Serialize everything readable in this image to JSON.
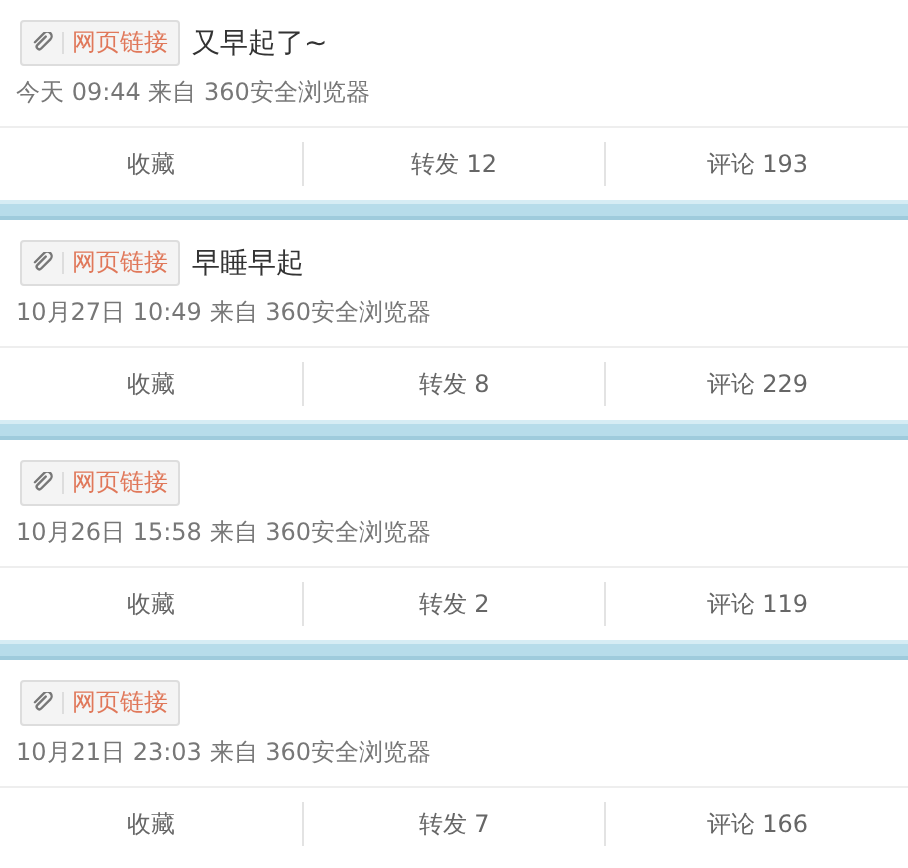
{
  "posts": [
    {
      "tag": "网页链接",
      "text": "又早起了~",
      "meta": "今天 09:44 来自 360安全浏览器",
      "actions": [
        "收藏",
        "转发 12",
        "评论 193"
      ]
    },
    {
      "tag": "网页链接",
      "text": "早睡早起",
      "meta": "10月27日 10:49 来自 360安全浏览器",
      "actions": [
        "收藏",
        "转发 8",
        "评论 229"
      ]
    },
    {
      "tag": "网页链接",
      "meta": "10月26日 15:58 来自 360安全浏览器",
      "actions": [
        "收藏",
        "转发 2",
        "评论 119"
      ]
    },
    {
      "tag": "网页链接",
      "meta": "10月21日 23:03 来自 360安全浏览器",
      "actions": [
        "收藏",
        "转发 7",
        "评论 166"
      ]
    }
  ]
}
